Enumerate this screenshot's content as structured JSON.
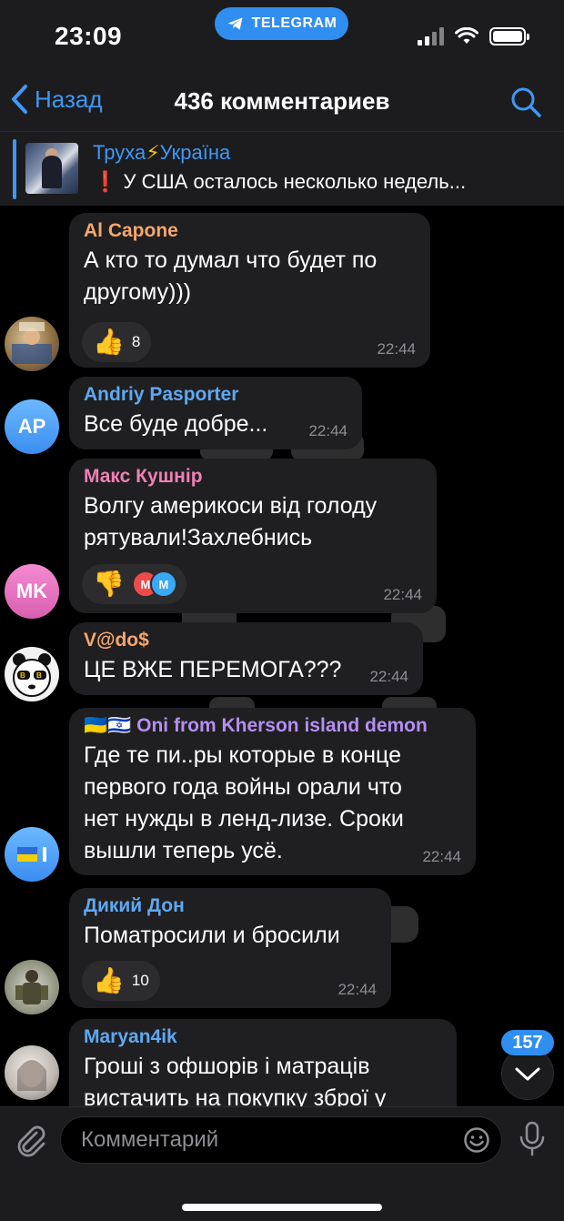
{
  "status": {
    "time": "23:09",
    "app_pill": "TELEGRAM"
  },
  "nav": {
    "back_label": "Назад",
    "title": "436 комментариев"
  },
  "pinned": {
    "channel_part1": "Труха",
    "channel_emoji": "⚡",
    "channel_part2": "Україна",
    "excl": "❗",
    "text": "У США осталось несколько недель..."
  },
  "messages": [
    {
      "name": "Al Capone",
      "name_color": "#f5a76e",
      "lines": [
        "А кто то думал что будет по",
        "другому)))"
      ],
      "time": "22:44",
      "reaction": {
        "emoji": "👍",
        "count": "8"
      }
    },
    {
      "name": "Andriy Pasporter",
      "name_color": "#5fa8f2",
      "avatar_text": "AP",
      "lines": [
        "Все буде добре..."
      ],
      "time": "22:44"
    },
    {
      "name": "Макс Кушнір",
      "name_color": "#f07fb6",
      "avatar_text": "MK",
      "lines": [
        "Волгу америкоси від голоду",
        "рятували!Захлебнись"
      ],
      "time": "22:44",
      "reaction": {
        "emoji": "👎",
        "avatars": [
          "M",
          "M"
        ]
      }
    },
    {
      "name": "V@do$",
      "name_color": "#f5a76e",
      "lines": [
        "ЦЕ ВЖЕ ПЕРЕМОГА???"
      ],
      "time": "22:44"
    },
    {
      "name": "🇺🇦🇮🇱 Oni from Kherson island demon",
      "name_color": "#b58ef2",
      "lines": [
        "Где те пи..ры которые в конце",
        "первого года войны орали что",
        "нет нужды в ленд-лизе. Сроки",
        "вышли теперь усё."
      ],
      "time": "22:44"
    },
    {
      "name": "Дикий Дон",
      "name_color": "#5fa8f2",
      "lines": [
        "Поматросили и бросили"
      ],
      "time": "22:44",
      "reaction": {
        "emoji": "👍",
        "count": "10"
      }
    },
    {
      "name": "Maryan4ik",
      "name_color": "#5fa8f2",
      "lines": [
        "Гроші з офшорів і матраців",
        "вистачить на покупку зброї у"
      ]
    }
  ],
  "scroll": {
    "unread_count": "157"
  },
  "input": {
    "placeholder": "Комментарий"
  }
}
